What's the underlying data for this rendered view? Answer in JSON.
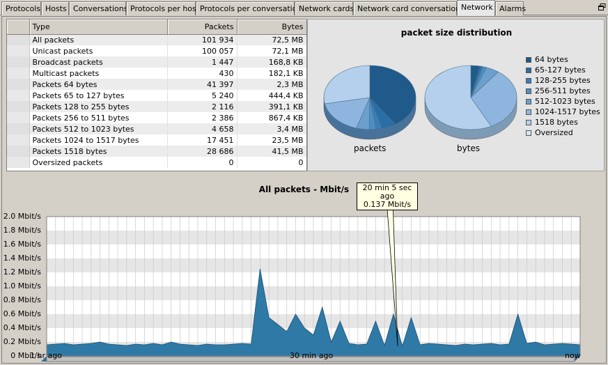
{
  "tabs": [
    {
      "label": "Protocols",
      "active": false
    },
    {
      "label": "Hosts",
      "active": false
    },
    {
      "label": "Conversations",
      "active": false
    },
    {
      "label": "Protocols per host",
      "active": false
    },
    {
      "label": "Protocols per conversation",
      "active": false
    },
    {
      "label": "Network cards",
      "active": false
    },
    {
      "label": "Network card conversations",
      "active": false
    },
    {
      "label": "Network",
      "active": true
    },
    {
      "label": "Alarms",
      "active": false
    }
  ],
  "table": {
    "headers": {
      "type": "Type",
      "packets": "Packets",
      "bytes": "Bytes"
    },
    "rows": [
      {
        "type": "All packets",
        "packets": "101 934",
        "bytes": "72,5 MB"
      },
      {
        "type": "Unicast packets",
        "packets": "100 057",
        "bytes": "72,1 MB"
      },
      {
        "type": "Broadcast packets",
        "packets": "1 447",
        "bytes": "168,8 KB"
      },
      {
        "type": "Multicast packets",
        "packets": "430",
        "bytes": "182,1 KB"
      },
      {
        "type": "Packets 64 bytes",
        "packets": "41 397",
        "bytes": "2,3 MB"
      },
      {
        "type": "Packets 65 to 127 bytes",
        "packets": "5 240",
        "bytes": "444,4 KB"
      },
      {
        "type": "Packets 128 to 255 bytes",
        "packets": "2 116",
        "bytes": "391,1 KB"
      },
      {
        "type": "Packets 256 to 511 bytes",
        "packets": "2 386",
        "bytes": "867,4 KB"
      },
      {
        "type": "Packets 512 to 1023 bytes",
        "packets": "4 658",
        "bytes": "3,4 MB"
      },
      {
        "type": "Packets 1024 to 1517 bytes",
        "packets": "17 451",
        "bytes": "23,5 MB"
      },
      {
        "type": "Packets 1518 bytes",
        "packets": "28 686",
        "bytes": "41,5 MB"
      },
      {
        "type": "Oversized packets",
        "packets": "0",
        "bytes": "0"
      }
    ]
  },
  "chart_data": [
    {
      "type": "pie",
      "title": "packet size distribution",
      "pies": [
        {
          "label": "packets",
          "values": [
            41397,
            5240,
            2116,
            2386,
            4658,
            17451,
            28686,
            0
          ]
        },
        {
          "label": "bytes",
          "values": [
            2.3,
            0.4444,
            0.3911,
            0.8674,
            3.4,
            23.5,
            41.5,
            0
          ]
        }
      ],
      "categories": [
        "64 bytes",
        "65-127 bytes",
        "128-255 bytes",
        "256-511 bytes",
        "512-1023 bytes",
        "1024-1517 bytes",
        "1518 bytes",
        "Oversized"
      ],
      "colors": [
        "#1f5a8a",
        "#2a6ea6",
        "#3a7fb6",
        "#4d8fc3",
        "#6b9fcc",
        "#8eb5dd",
        "#b4d0ec",
        "#d6e6f5"
      ],
      "legend": "right"
    },
    {
      "type": "area",
      "title": "All packets - Mbit/s",
      "ylabel": "Mbit/s",
      "ylim": [
        0,
        2.0
      ],
      "yticks": [
        "0 Mbit/s",
        "0.2 Mbit/s",
        "0.4 Mbit/s",
        "0.6 Mbit/s",
        "0.8 Mbit/s",
        "1.0 Mbit/s",
        "1.2 Mbit/s",
        "1.4 Mbit/s",
        "1.6 Mbit/s",
        "1.8 Mbit/s",
        "2.0 Mbit/s"
      ],
      "xticks": [
        "1 hr ago",
        "30 min ago",
        "now"
      ],
      "x_minutes_ago": [
        60,
        59,
        58,
        57,
        56,
        55,
        54,
        53,
        52,
        51,
        50,
        49,
        48,
        47,
        46,
        45,
        44,
        43,
        42,
        41,
        40,
        39,
        38,
        37,
        36,
        35,
        34,
        33,
        32,
        31,
        30,
        29,
        28,
        27,
        26,
        25,
        24,
        23,
        22,
        21,
        20,
        19,
        18,
        17,
        16,
        15,
        14,
        13,
        12,
        11,
        10,
        9,
        8,
        7,
        6,
        5,
        4,
        3,
        2,
        1,
        0
      ],
      "values": [
        0.16,
        0.17,
        0.18,
        0.16,
        0.17,
        0.18,
        0.2,
        0.17,
        0.16,
        0.15,
        0.17,
        0.16,
        0.18,
        0.16,
        0.2,
        0.17,
        0.16,
        0.15,
        0.17,
        0.16,
        0.16,
        0.17,
        0.18,
        0.17,
        1.25,
        0.55,
        0.45,
        0.35,
        0.6,
        0.4,
        0.3,
        0.7,
        0.2,
        0.5,
        0.18,
        0.16,
        0.17,
        0.5,
        0.15,
        0.6,
        0.14,
        0.55,
        0.16,
        0.18,
        0.17,
        0.16,
        0.15,
        0.17,
        0.16,
        0.17,
        0.18,
        0.16,
        0.17,
        0.6,
        0.18,
        0.2,
        0.16,
        0.17,
        0.18,
        0.17,
        0.16
      ],
      "tooltip": {
        "line1": "20 min 5 sec ago",
        "line2": "0.137 Mbit/s"
      },
      "grid": true
    }
  ]
}
